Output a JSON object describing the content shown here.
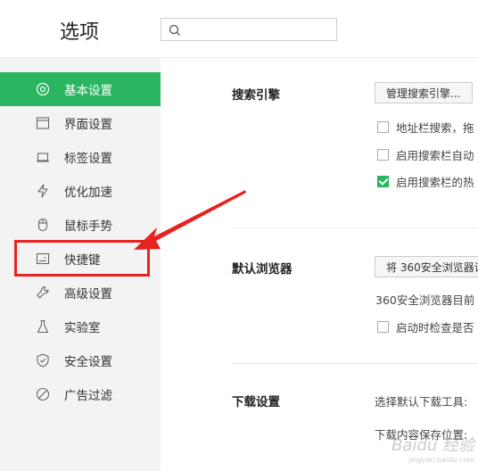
{
  "header": {
    "title": "选项",
    "search_placeholder": ""
  },
  "sidebar": {
    "items": [
      {
        "label": "基本设置",
        "icon": "target-icon",
        "active": true
      },
      {
        "label": "界面设置",
        "icon": "window-icon"
      },
      {
        "label": "标签设置",
        "icon": "tab-icon"
      },
      {
        "label": "优化加速",
        "icon": "lightning-icon"
      },
      {
        "label": "鼠标手势",
        "icon": "mouse-icon"
      },
      {
        "label": "快捷键",
        "icon": "keyboard-icon"
      },
      {
        "label": "高级设置",
        "icon": "wrench-icon"
      },
      {
        "label": "实验室",
        "icon": "flask-icon"
      },
      {
        "label": "安全设置",
        "icon": "shield-icon"
      },
      {
        "label": "广告过滤",
        "icon": "block-icon"
      }
    ]
  },
  "main": {
    "search_engine": {
      "title": "搜索引擎",
      "manage_button": "管理搜索引擎...",
      "options": [
        {
          "label": "地址栏搜索，拖",
          "checked": false
        },
        {
          "label": "启用搜索栏自动",
          "checked": false
        },
        {
          "label": "启用搜索栏的热",
          "checked": true
        }
      ]
    },
    "default_browser": {
      "title": "默认浏览器",
      "set_button": "将 360安全浏览器设",
      "status_text": "360安全浏览器目前",
      "options": [
        {
          "label": "启动时检查是否",
          "checked": false
        }
      ]
    },
    "download": {
      "title": "下载设置",
      "tool_label": "选择默认下载工具:",
      "location_label": "下载内容保存位置:"
    }
  },
  "watermark": {
    "brand": "Baidu 经验",
    "url": "jingyan.baidu.com"
  },
  "colors": {
    "accent": "#2bb560",
    "highlight": "#e8231f",
    "sidebar_bg": "#f3f3f3"
  }
}
